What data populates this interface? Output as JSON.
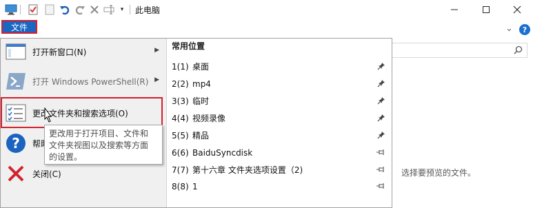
{
  "window": {
    "title": "此电脑",
    "controls": {
      "minimize": "—",
      "maximize": "☐",
      "close": "✕"
    }
  },
  "ribbon": {
    "file_tab": "文件",
    "expand_glyph": "⌄",
    "help_glyph": "?"
  },
  "menu": {
    "items": [
      {
        "label": "打开新窗口(N)",
        "icon": "new-window-icon",
        "has_submenu": true,
        "enabled": true
      },
      {
        "label": "打开 Windows PowerShell(R)",
        "icon": "powershell-icon",
        "has_submenu": true,
        "enabled": false
      },
      {
        "label": "更改文件夹和搜索选项(O)",
        "icon": "folder-options-icon",
        "has_submenu": false,
        "enabled": true,
        "highlighted": true
      },
      {
        "label": "帮助",
        "icon": "help-icon",
        "has_submenu": true,
        "enabled": true
      },
      {
        "label": "关闭(C)",
        "icon": "close-icon",
        "has_submenu": false,
        "enabled": true
      }
    ],
    "tooltip": {
      "lines": [
        "更改用于打开项目、文件和",
        "文件夹视图以及搜索等方面",
        "的设置。"
      ]
    }
  },
  "frequent_places": {
    "header": "常用位置",
    "items": [
      {
        "index": "1(1)",
        "name": "桌面",
        "pinned": true
      },
      {
        "index": "2(2)",
        "name": "mp4",
        "pinned": true
      },
      {
        "index": "3(3)",
        "name": "临时",
        "pinned": true
      },
      {
        "index": "4(4)",
        "name": "视频录像",
        "pinned": true
      },
      {
        "index": "5(5)",
        "name": "精品",
        "pinned": true
      },
      {
        "index": "6(6)",
        "name": "BaiduSyncdisk",
        "pinned": false
      },
      {
        "index": "7(7)",
        "name": "第十六章 文件夹选项设置（2)",
        "pinned": false
      },
      {
        "index": "8(8)",
        "name": "1",
        "pinned": false
      }
    ]
  },
  "preview_pane": {
    "message": "选择要预览的文件。"
  },
  "colors": {
    "accent": "#1a66c2",
    "highlight_border": "#d21f2c",
    "menu_bg": "#f0f0f0"
  }
}
